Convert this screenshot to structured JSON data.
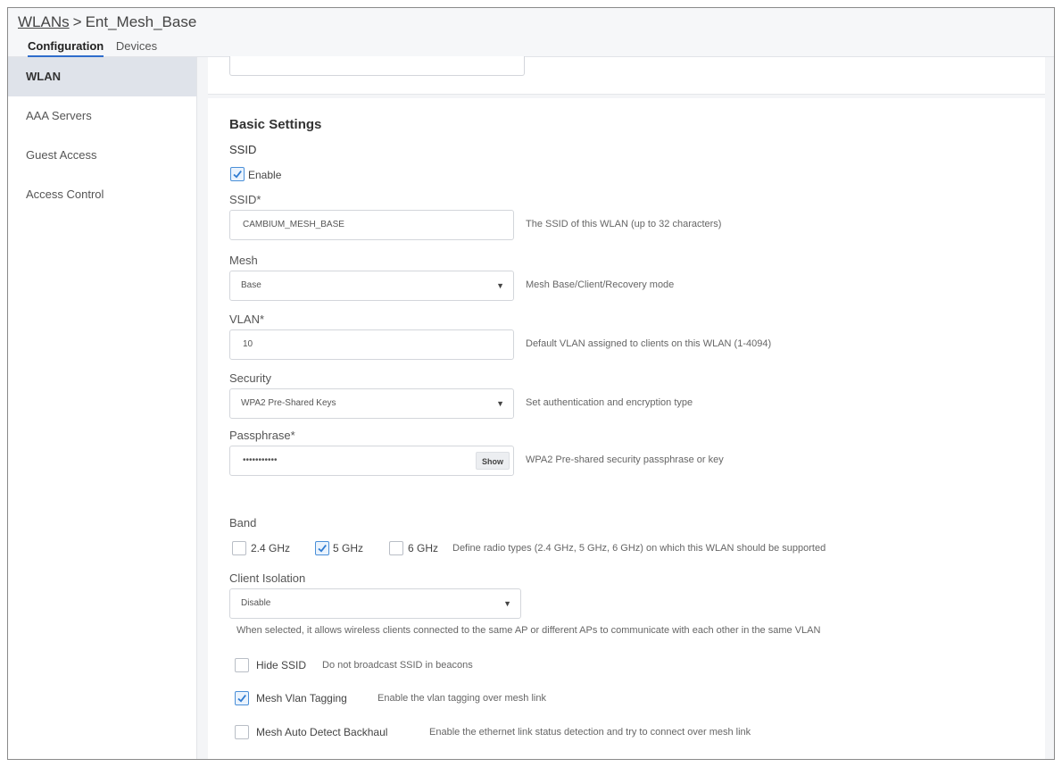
{
  "breadcrumb": {
    "parent": "WLANs",
    "separator": ">",
    "current": "Ent_Mesh_Base"
  },
  "tabs": [
    {
      "label": "Configuration",
      "active": true
    },
    {
      "label": "Devices",
      "active": false
    }
  ],
  "sidebar": {
    "items": [
      {
        "label": "WLAN",
        "active": true
      },
      {
        "label": "AAA Servers",
        "active": false
      },
      {
        "label": "Guest Access",
        "active": false
      },
      {
        "label": "Access Control",
        "active": false
      }
    ]
  },
  "form": {
    "section_title": "Basic Settings",
    "ssid_heading": "SSID",
    "enable": {
      "label": "Enable",
      "checked": true
    },
    "ssid": {
      "label": "SSID*",
      "value": "CAMBIUM_MESH_BASE",
      "hint": "The SSID of this WLAN (up to 32 characters)"
    },
    "mesh": {
      "label": "Mesh",
      "value": "Base",
      "hint": "Mesh Base/Client/Recovery mode"
    },
    "vlan": {
      "label": "VLAN*",
      "value": "10",
      "hint": "Default VLAN assigned to clients on this WLAN (1-4094)"
    },
    "security": {
      "label": "Security",
      "value": "WPA2 Pre-Shared Keys",
      "hint": "Set authentication and encryption type"
    },
    "passphrase": {
      "label": "Passphrase*",
      "value": "•••••••••••",
      "show_label": "Show",
      "hint": "WPA2 Pre-shared security passphrase or key"
    },
    "band": {
      "label": "Band",
      "options": [
        {
          "label": "2.4 GHz",
          "checked": false
        },
        {
          "label": "5 GHz",
          "checked": true
        },
        {
          "label": "6 GHz",
          "checked": false
        }
      ],
      "hint": "Define radio types (2.4 GHz, 5 GHz, 6 GHz) on which this WLAN should be supported"
    },
    "client_isolation": {
      "label": "Client Isolation",
      "value": "Disable",
      "hint": "When selected, it allows wireless clients connected to the same AP or different APs to communicate with each other in the same VLAN"
    },
    "hide_ssid": {
      "label": "Hide SSID",
      "desc": "Do not broadcast SSID in beacons",
      "checked": false
    },
    "mesh_vlan_tagging": {
      "label": "Mesh Vlan Tagging",
      "desc": "Enable the vlan tagging over mesh link",
      "checked": true
    },
    "mesh_auto_detect": {
      "label": "Mesh Auto Detect Backhaul",
      "desc": "Enable the ethernet link status detection and try to connect over mesh link",
      "checked": false
    }
  },
  "colors": {
    "accent": "#2f6dcc",
    "checkbox": "#4a8fd8",
    "sidebar_active": "#dfe3ea"
  }
}
